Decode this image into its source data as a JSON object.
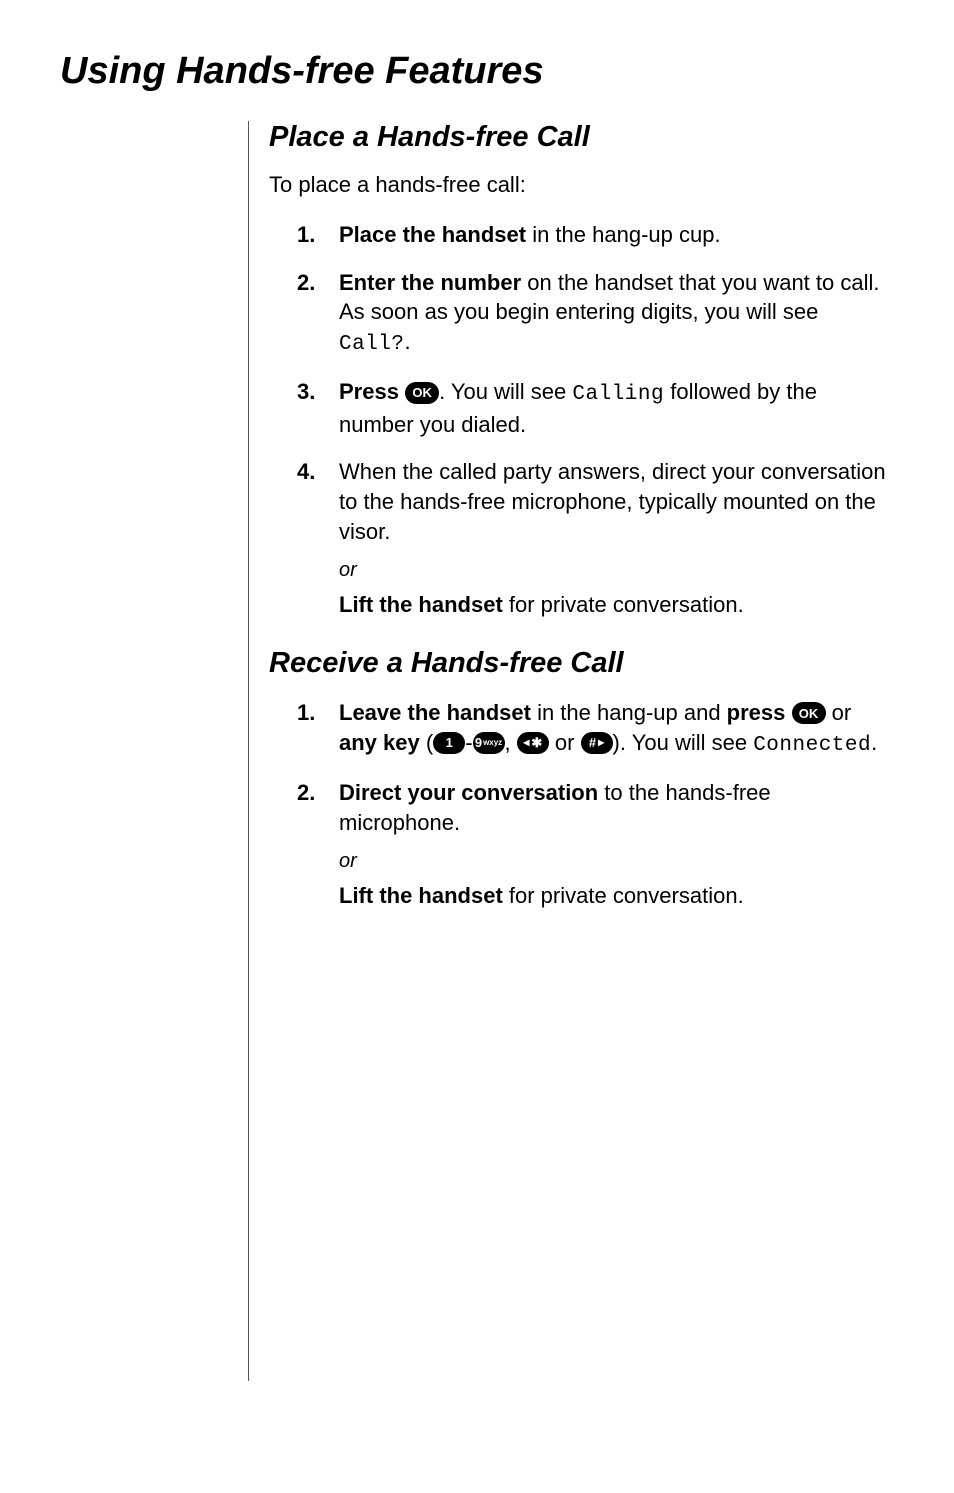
{
  "title": "Using Hands-free Features",
  "section1": {
    "heading": "Place a Hands-free Call",
    "intro": "To place a hands-free call:",
    "steps": [
      {
        "n": "1.",
        "bold": "Place the handset",
        "tail": " in the hang-up cup."
      },
      {
        "n": "2.",
        "bold": "Enter the number",
        "tail_a": " on the handset that you want to call. As soon as you begin entering digits, you will see ",
        "lcd": "Call?",
        "tail_b": "."
      },
      {
        "n": "3.",
        "bold": "Press",
        "mid_a": " ",
        "ok": true,
        "mid_b": ". You will see ",
        "lcd": "Calling",
        "tail": " followed by the number you dialed."
      },
      {
        "n": "4.",
        "text": "When the called party answers, direct your conversation to the hands-free microphone, typically mounted on the visor."
      }
    ],
    "or": "or",
    "privstep": {
      "bold": "Lift the handset",
      "tail": " for private conversation."
    }
  },
  "section2": {
    "heading": "Receive a Hands-free Call",
    "steps": [
      {
        "n": "1.",
        "bold": "Leave the handset",
        "mid1": " in the hang-up and ",
        "bold2": "press",
        "mid2": " ",
        "ok": true,
        "mid3": " or ",
        "bold3": "any key",
        "mid4": " (",
        "k1": "1",
        "dash": "-",
        "k9": "9",
        "k9s": "wxyz",
        "mid5": ", ",
        "star": "✱",
        "mid6": " or ",
        "hash": "#",
        "mid7": "). You will see ",
        "lcd": "Connected",
        "tail": "."
      },
      {
        "n": "2.",
        "bold": "Direct your conversation",
        "tail": " to the hands-free microphone."
      }
    ],
    "or": "or",
    "privstep": {
      "bold": "Lift the handset",
      "tail": " for private conversation."
    }
  }
}
